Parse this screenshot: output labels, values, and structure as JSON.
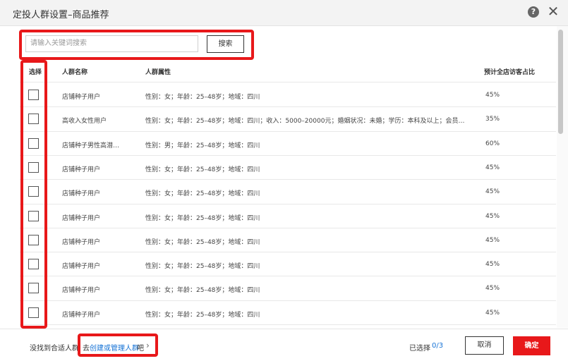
{
  "dialog": {
    "title": "定投人群设置–商品推荐"
  },
  "search": {
    "placeholder": "请输入关键词搜索",
    "button_label": "搜索"
  },
  "table": {
    "headers": {
      "select": "选择",
      "name": "人群名称",
      "attributes": "人群属性",
      "ratio": "预计全店访客占比"
    },
    "rows": [
      {
        "name": "店铺种子用户",
        "attributes": "性别：女；年龄：25–48岁；地域：四川",
        "ratio": "45%"
      },
      {
        "name": "高收入女性用户",
        "attributes": "性别：女；年龄：25–48岁；地域：四川；收入：5000–20000元；婚姻状况：未婚；学历：本科及以上；会员…",
        "ratio": "35%"
      },
      {
        "name": "店铺种子男性高潜…",
        "attributes": "性别：男；年龄：25–48岁；地域：四川",
        "ratio": "60%"
      },
      {
        "name": "店铺种子用户",
        "attributes": "性别：女；年龄：25–48岁；地域：四川",
        "ratio": "45%"
      },
      {
        "name": "店铺种子用户",
        "attributes": "性别：女；年龄：25–48岁；地域：四川",
        "ratio": "45%"
      },
      {
        "name": "店铺种子用户",
        "attributes": "性别：女；年龄：25–48岁；地域：四川",
        "ratio": "45%"
      },
      {
        "name": "店铺种子用户",
        "attributes": "性别：女；年龄：25–48岁；地域：四川",
        "ratio": "45%"
      },
      {
        "name": "店铺种子用户",
        "attributes": "性别：女；年龄：25–48岁；地域：四川",
        "ratio": "45%"
      },
      {
        "name": "店铺种子用户",
        "attributes": "性别：女；年龄：25–48岁；地域：四川",
        "ratio": "45%"
      },
      {
        "name": "店铺种子用户",
        "attributes": "性别：女；年龄：25–48岁；地域：四川",
        "ratio": "45%"
      }
    ]
  },
  "footer": {
    "hint": "没找到合适人群",
    "link_prefix": "去",
    "link": "创建或管理人群",
    "link_suffix": "吧",
    "selected_label": "已选择",
    "selected_count": "0/3",
    "cancel_label": "取消",
    "confirm_label": "确定"
  },
  "colors": {
    "accent": "#e8181a",
    "link": "#1673d6"
  },
  "icons": {
    "help": "question-circle-icon",
    "close": "close-icon",
    "chevron": "chevron-right-icon"
  }
}
